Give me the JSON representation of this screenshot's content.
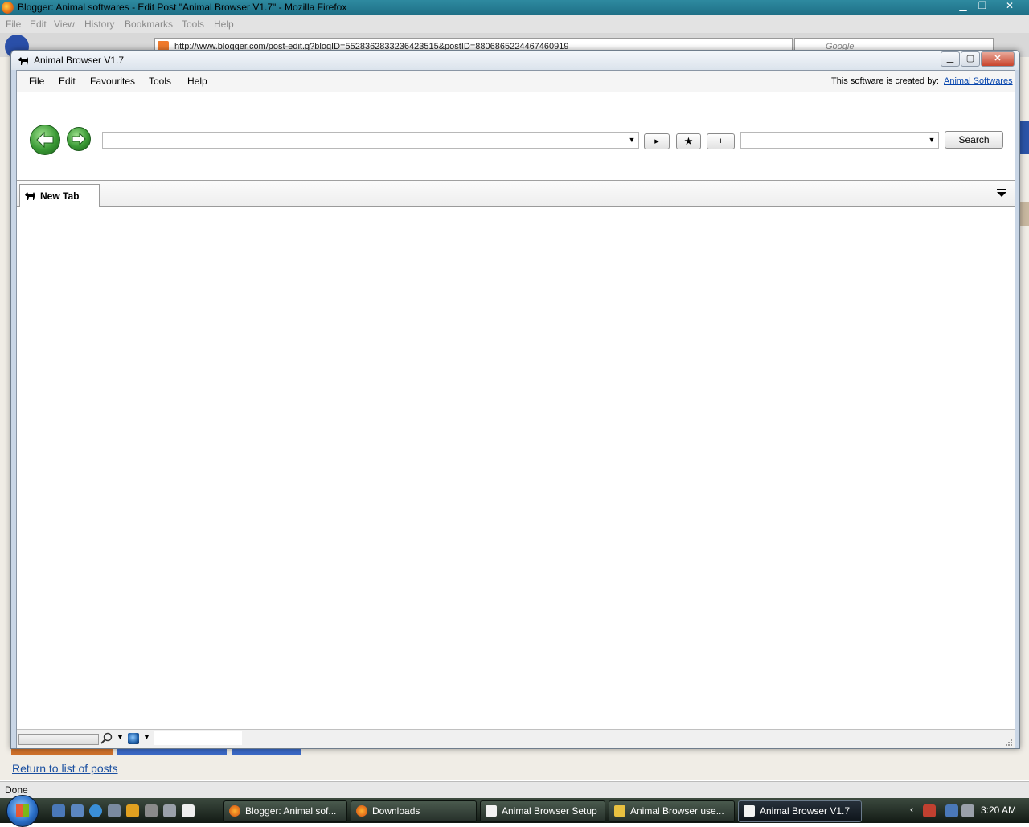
{
  "firefox": {
    "title": "Blogger: Animal softwares - Edit Post \"Animal Browser V1.7\" - Mozilla Firefox",
    "menu": [
      "File",
      "Edit",
      "View",
      "History",
      "Bookmarks",
      "Tools",
      "Help"
    ],
    "url": "http://www.blogger.com/post-edit.g?blogID=5528362833236423515&postID=8806865224467460919",
    "search_placeholder": "Google",
    "return_link": "Return to list of posts",
    "status": "Done"
  },
  "animal_browser": {
    "title": "Animal Browser V1.7",
    "menu": [
      "File",
      "Edit",
      "Favourites",
      "Tools",
      "Help"
    ],
    "credit_text": "This software is created by:",
    "credit_link": "Animal Softwares",
    "address_value": "",
    "go_button": "▸",
    "favourite_button": "★",
    "add_button": "+",
    "search_value": "",
    "search_button": "Search",
    "tab_label": "New Tab"
  },
  "taskbar": {
    "tasks": [
      {
        "label": "Blogger: Animal sof...",
        "icon": "firefox-icon"
      },
      {
        "label": "Downloads",
        "icon": "firefox-icon"
      },
      {
        "label": "Animal Browser Setup",
        "icon": "animal-icon"
      },
      {
        "label": "Animal Browser use...",
        "icon": "archive-icon"
      },
      {
        "label": "Animal Browser V1.7",
        "icon": "animal-icon"
      }
    ],
    "clock": "3:20 AM"
  },
  "colors": {
    "nav_green": "#3a9a35",
    "link_blue": "#0645ad",
    "firefox_title": "#2e8aa0"
  }
}
